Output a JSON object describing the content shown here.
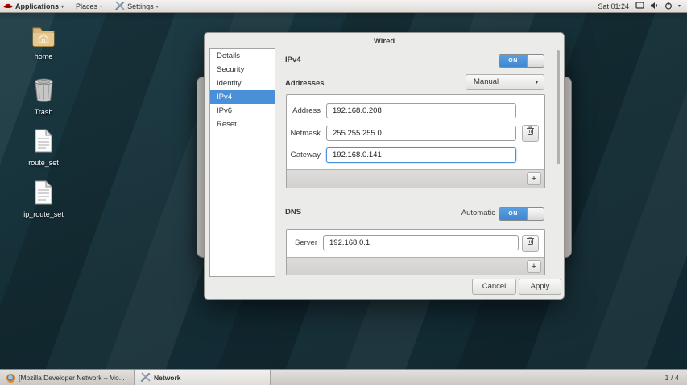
{
  "icons": {
    "dropdown_arrow": "▾",
    "plus": "+"
  },
  "topbar": {
    "menus": [
      {
        "label": "Applications"
      },
      {
        "label": "Places"
      },
      {
        "label": "Settings"
      }
    ],
    "clock": "Sat 01:24"
  },
  "desktop": {
    "icons": [
      {
        "label": "home"
      },
      {
        "label": "Trash"
      },
      {
        "label": "route_set"
      },
      {
        "label": "ip_route_set"
      }
    ]
  },
  "dialog": {
    "title": "Wired",
    "sidebar": {
      "items": [
        "Details",
        "Security",
        "Identity",
        "IPv4",
        "IPv6",
        "Reset"
      ],
      "selected": "IPv4"
    },
    "ipv4": {
      "label": "IPv4",
      "toggle": "ON"
    },
    "addresses": {
      "label": "Addresses",
      "method": "Manual",
      "rows": [
        {
          "label": "Address",
          "value": "192.168.0.208"
        },
        {
          "label": "Netmask",
          "value": "255.255.255.0"
        },
        {
          "label": "Gateway",
          "value": "192.168.0.141"
        }
      ]
    },
    "dns": {
      "label": "DNS",
      "automatic_label": "Automatic",
      "toggle": "ON",
      "server": {
        "label": "Server",
        "value": "192.168.0.1"
      }
    },
    "actions": {
      "cancel": "Cancel",
      "apply": "Apply"
    }
  },
  "taskbar": {
    "windows": [
      {
        "label": "[Mozilla Developer Network – Mo..."
      },
      {
        "label": "Network"
      }
    ],
    "workspace": "1 / 4"
  },
  "colors": {
    "accent": "#4a90d9",
    "desktop_base": "#17333c",
    "dialog_bg": "#ebebe9",
    "hat_red": "#bb0000"
  }
}
